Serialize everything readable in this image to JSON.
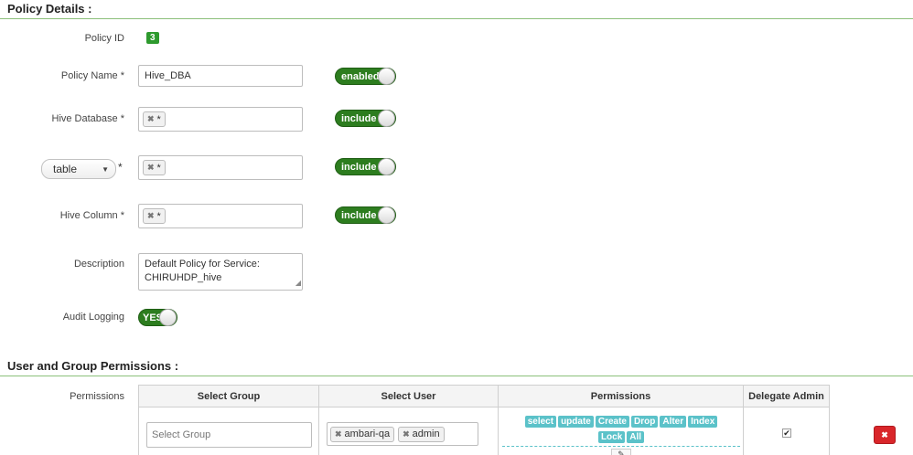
{
  "policy_details": {
    "title": "Policy Details :",
    "policy_id_label": "Policy ID",
    "policy_id": "3",
    "policy_name_label": "Policy Name *",
    "policy_name": "Hive_DBA",
    "policy_toggle": "enabled",
    "hive_database_label": "Hive Database *",
    "hive_database_tag": "*",
    "database_toggle": "include",
    "resource_type": "table",
    "resource_required": "*",
    "table_tag": "*",
    "table_toggle": "include",
    "hive_column_label": "Hive Column *",
    "column_tag": "*",
    "column_toggle": "include",
    "description_label": "Description",
    "description": "Default Policy for Service: CHIRUHDP_hive",
    "audit_label": "Audit Logging",
    "audit_toggle": "YES"
  },
  "permissions_section": {
    "title": "User and Group Permissions :",
    "permissions_label": "Permissions",
    "columns": [
      "Select Group",
      "Select User",
      "Permissions",
      "Delegate Admin"
    ],
    "group_placeholder": "Select Group",
    "users": [
      "ambari-qa",
      "admin"
    ],
    "permission_chips": [
      "select",
      "update",
      "Create",
      "Drop",
      "Alter",
      "Index",
      "Lock",
      "All"
    ],
    "delegate_admin_checked": true
  },
  "colors": {
    "toggle_green": "#2d7d1f",
    "badge_green": "#2e9a2e",
    "chip_teal": "#5bc2c9",
    "delete_red": "#d9262a"
  }
}
